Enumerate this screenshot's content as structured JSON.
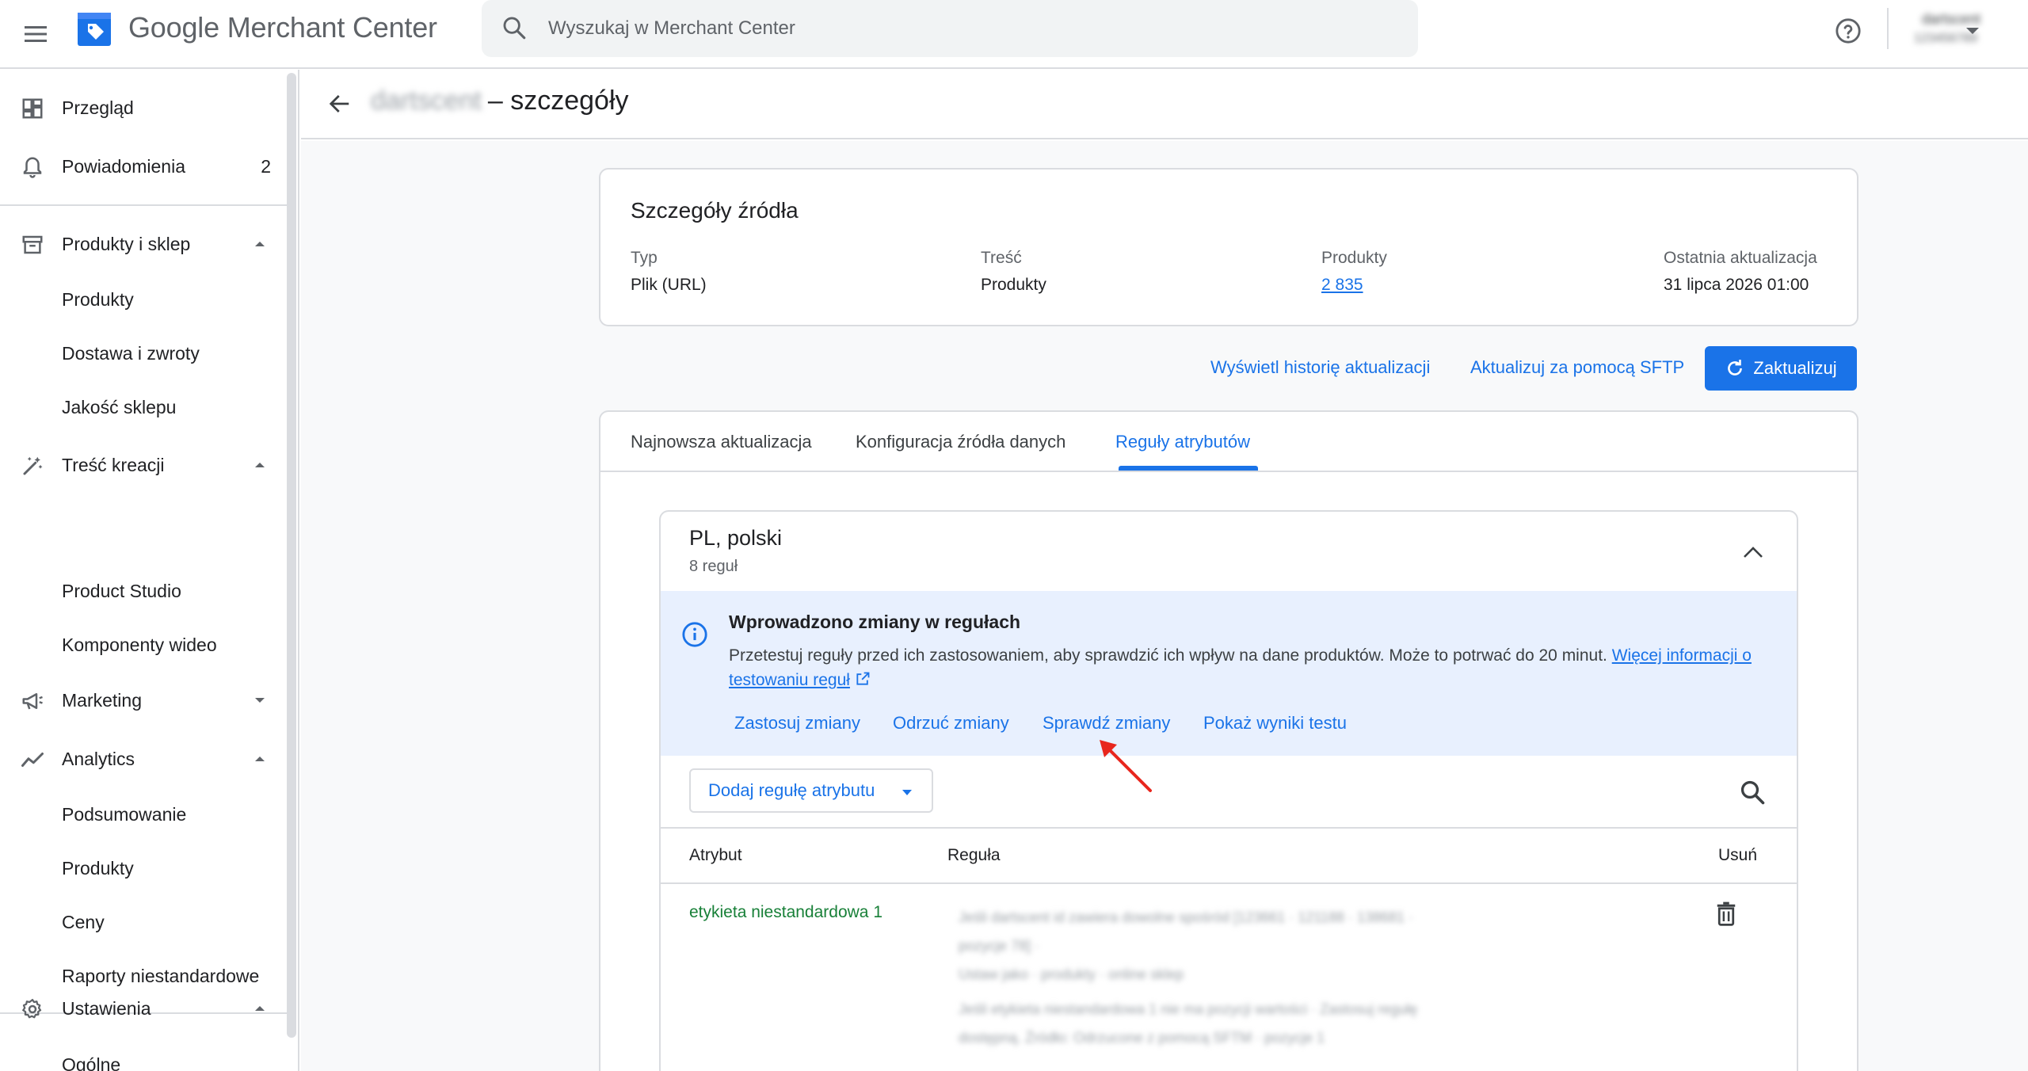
{
  "app": {
    "brand": "Google Merchant Center",
    "search_placeholder": "Wyszukaj w Merchant Center",
    "account_name": "dartscent",
    "account_id": "123456789"
  },
  "sidebar": {
    "overview": "Przegląd",
    "notifications": "Powiadomienia",
    "notifications_count": "2",
    "products_store": "Produkty i sklep",
    "products": "Produkty",
    "shipping": "Dostawa i zwroty",
    "store_quality": "Jakość sklepu",
    "creative": "Treść kreacji",
    "product_studio": "Product Studio",
    "video": "Komponenty wideo",
    "marketing": "Marketing",
    "analytics": "Analytics",
    "summary": "Podsumowanie",
    "analytics_products": "Produkty",
    "prices": "Ceny",
    "custom_reports": "Raporty niestandardowe",
    "settings": "Ustawienia",
    "general": "Ogólne"
  },
  "header": {
    "source_name": "dartscent",
    "title_suffix": "– szczegóły"
  },
  "details": {
    "title": "Szczegóły źródła",
    "type_label": "Typ",
    "type_value": "Plik (URL)",
    "content_label": "Treść",
    "content_value": "Produkty",
    "products_label": "Produkty",
    "products_value": "2 835",
    "updated_label": "Ostatnia aktualizacja",
    "updated_value": "31 lipca 2026 01:00"
  },
  "actions": {
    "history": "Wyświetl historię aktualizacji",
    "sftp": "Aktualizuj za pomocą SFTP",
    "refresh": "Zaktualizuj"
  },
  "tabs": {
    "latest": "Najnowsza aktualizacja",
    "config": "Konfiguracja źródła danych",
    "rules": "Reguły atrybutów"
  },
  "rules": {
    "locale": "PL, polski",
    "count": "8 reguł",
    "banner_title": "Wprowadzono zmiany w regułach",
    "banner_text": "Przetestuj reguły przed ich zastosowaniem, aby sprawdzić ich wpływ na dane produktów. Może to potrwać do 20 minut.",
    "banner_link": "Więcej informacji o testowaniu reguł",
    "apply": "Zastosuj zmiany",
    "discard": "Odrzuć zmiany",
    "check": "Sprawdź zmiany",
    "show_results": "Pokaż wyniki testu",
    "add_rule": "Dodaj regułę atrybutu",
    "col_attribute": "Atrybut",
    "col_rule": "Reguła",
    "col_delete": "Usuń",
    "row1_attribute": "etykieta niestandardowa 1",
    "row1_rule_lines": [
      "Jeśli dartscent id zawiera dowolne spośród [123661 · 121188 · 138681 ·",
      "pozycje 78] ·",
      "Ustaw jako · produkty · online sklep",
      "Jeśli etykieta niestandardowa 1 nie ma pozycji wartości · Zastosuj regułę",
      "dostępną. Źródło: Odrzucone z pomocą SFTM · pozycje 1"
    ]
  },
  "colors": {
    "accent": "#1a73e8",
    "green": "#188038",
    "banner_bg": "#e8f0fe",
    "annotation": "#e8261d"
  }
}
